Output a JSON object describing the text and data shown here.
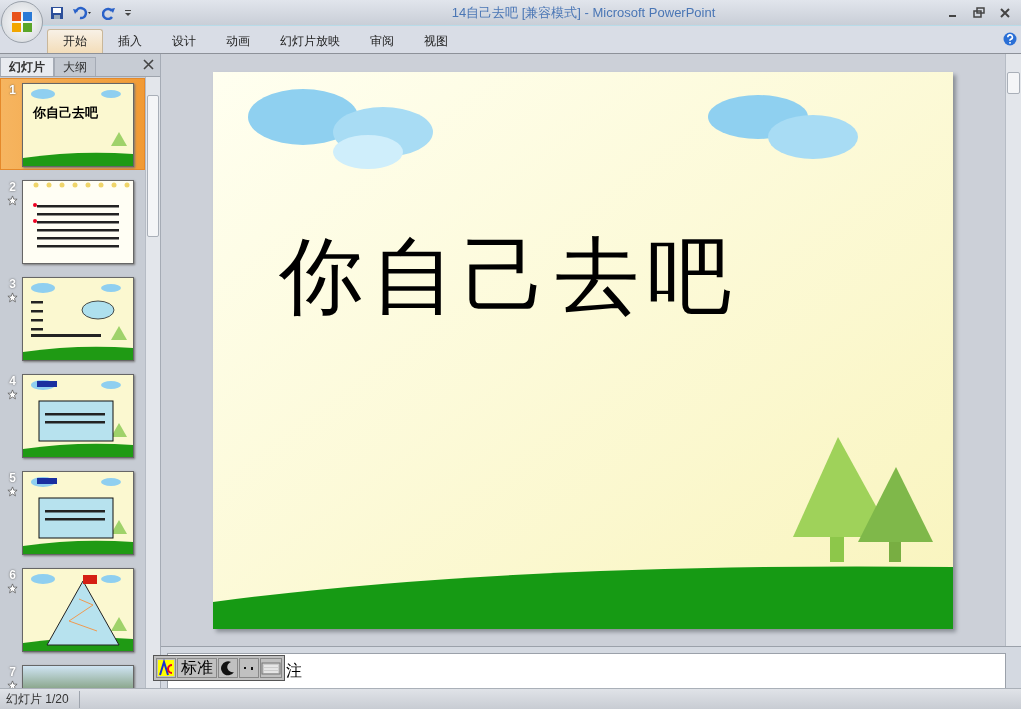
{
  "window": {
    "title": "14自己去吧 [兼容模式] - Microsoft PowerPoint"
  },
  "ribbon_tabs": [
    {
      "label": "开始",
      "selected": true
    },
    {
      "label": "插入",
      "selected": false
    },
    {
      "label": "设计",
      "selected": false
    },
    {
      "label": "动画",
      "selected": false
    },
    {
      "label": "幻灯片放映",
      "selected": false
    },
    {
      "label": "审阅",
      "selected": false
    },
    {
      "label": "视图",
      "selected": false
    }
  ],
  "panel_tabs": [
    {
      "label": "幻灯片",
      "selected": true
    },
    {
      "label": "大纲",
      "selected": false
    }
  ],
  "slides": [
    {
      "number": "1",
      "kind": "title",
      "title": "你自己去吧",
      "selected": true,
      "animated": false
    },
    {
      "number": "2",
      "kind": "text",
      "selected": false,
      "animated": true
    },
    {
      "number": "3",
      "kind": "pinyin",
      "selected": false,
      "animated": true
    },
    {
      "number": "4",
      "kind": "box",
      "selected": false,
      "animated": true
    },
    {
      "number": "5",
      "kind": "box",
      "selected": false,
      "animated": true
    },
    {
      "number": "6",
      "kind": "mountain",
      "selected": false,
      "animated": true
    },
    {
      "number": "7",
      "kind": "photo",
      "selected": false,
      "animated": true
    }
  ],
  "slide": {
    "title": "你自己去吧"
  },
  "notes": {
    "text": "注"
  },
  "ime_toolbar": {
    "mode": "标准"
  },
  "status_bar": {
    "slide_counter": "幻灯片 1/20"
  }
}
